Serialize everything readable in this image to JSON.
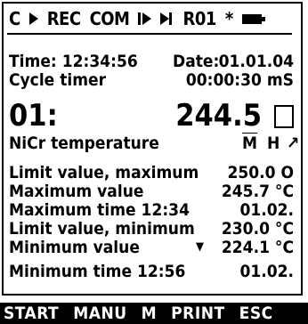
{
  "status": {
    "channel": "C",
    "rec": "REC",
    "com": "COM",
    "range": "R01",
    "star": "*"
  },
  "info": {
    "time_label": "Time: 12:34:56",
    "date_label": "Date:",
    "date_value": "01.01.04",
    "cycle_label": "Cycle timer",
    "cycle_value": "00:00:30 mS"
  },
  "measurement": {
    "channel_no": "01:",
    "value": "244.5",
    "sensor": "NiCr temperature",
    "mode_m": "M",
    "mode_h": "H",
    "trend": "↗"
  },
  "stats": [
    {
      "label": "Limit value, maximum",
      "value": "250.0 O"
    },
    {
      "label": "Maximum value",
      "value": "245.7 °C"
    },
    {
      "label": "Maximum time  12:34",
      "value": "01.02."
    },
    {
      "label": "Limit value, minimum",
      "value": "230.0 °C"
    },
    {
      "label": "Minimum value",
      "value": "224.1 °C"
    },
    {
      "label": "Minimum time  12:56",
      "value": "01.02."
    }
  ],
  "function_keys": [
    "START",
    "MANU",
    "M",
    "PRINT",
    "ESC"
  ]
}
